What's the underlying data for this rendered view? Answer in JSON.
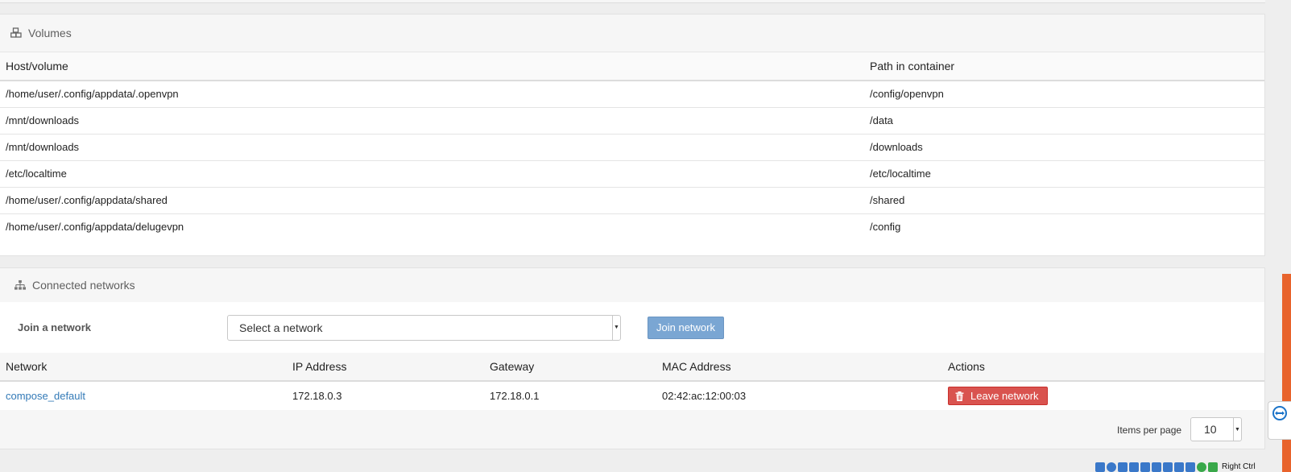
{
  "volumes": {
    "title": "Volumes",
    "icon": "cubes-icon",
    "columns": [
      "Host/volume",
      "Path in container"
    ],
    "rows": [
      [
        "/home/user/.config/appdata/.openvpn",
        "/config/openvpn"
      ],
      [
        "/mnt/downloads",
        "/data"
      ],
      [
        "/mnt/downloads",
        "/downloads"
      ],
      [
        "/etc/localtime",
        "/etc/localtime"
      ],
      [
        "/home/user/.config/appdata/shared",
        "/shared"
      ],
      [
        "/home/user/.config/appdata/delugevpn",
        "/config"
      ]
    ]
  },
  "networks": {
    "title": "Connected networks",
    "icon": "sitemap-icon",
    "join_label": "Join a network",
    "select_placeholder": "Select a network",
    "join_button": "Join network",
    "columns": [
      "Network",
      "IP Address",
      "Gateway",
      "MAC Address",
      "Actions"
    ],
    "rows": [
      {
        "network": "compose_default",
        "ip": "172.18.0.3",
        "gateway": "172.18.0.1",
        "mac": "02:42:ac:12:00:03",
        "action": "Leave network"
      }
    ],
    "items_per_page_label": "Items per page",
    "items_per_page_value": "10"
  },
  "taskbar": {
    "right_ctrl": "Right Ctrl"
  },
  "colors": {
    "link": "#337ab7",
    "primary_button": "#7aa6d3",
    "danger_button": "#d9534f",
    "accent_bar": "#e8632c"
  }
}
